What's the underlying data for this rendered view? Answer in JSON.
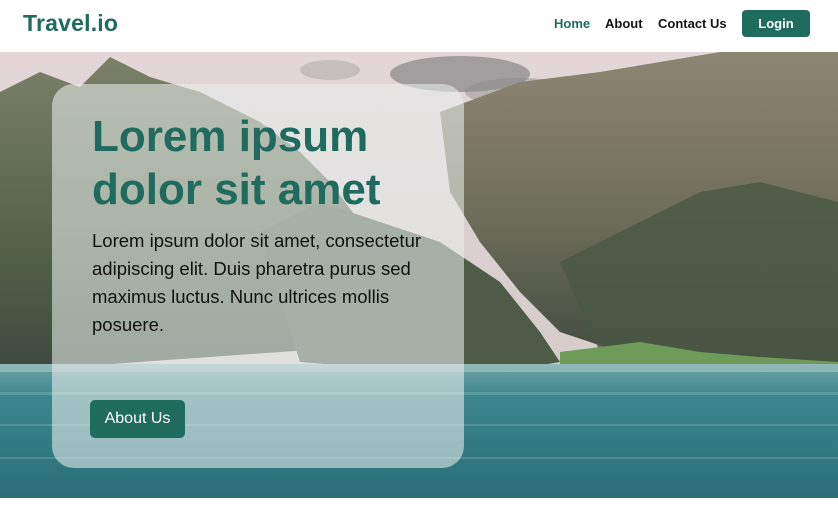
{
  "header": {
    "logo": "Travel.io",
    "nav": {
      "home": "Home",
      "about": "About",
      "contact": "Contact Us"
    },
    "login_label": "Login"
  },
  "hero": {
    "title": "Lorem ipsum dolor sit amet",
    "text": "Lorem ipsum dolor sit amet, consectetur adipiscing elit. Duis pharetra  purus sed maximus luctus. Nunc ultrices mollis posuere.",
    "button_label": "About Us"
  },
  "colors": {
    "brand": "#1f6b5e",
    "text": "#141414",
    "card_overlay": "rgba(232,238,236,0.58)",
    "sea": "#2f7c84",
    "cliff": "#5b6650"
  }
}
